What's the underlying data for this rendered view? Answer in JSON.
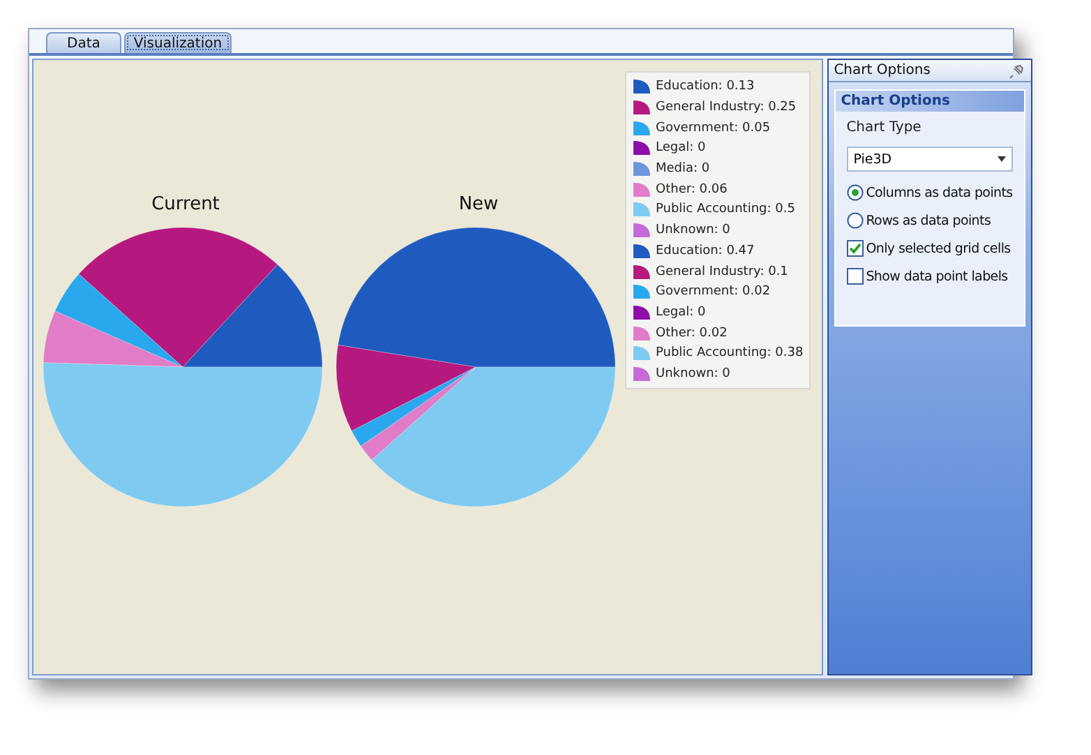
{
  "tabs": [
    {
      "label": "Data",
      "selected": false
    },
    {
      "label": "Visualization",
      "selected": true
    }
  ],
  "charts": [
    {
      "chart_data": {
        "type": "pie",
        "title": "Current",
        "values": [
          0.13,
          0.25,
          0.05,
          0,
          0,
          0.06,
          0.5,
          0
        ]
      },
      "legend": [
        {
          "label": "Education: 0.13",
          "color": "#1f5bbf"
        },
        {
          "label": "General Industry: 0.25",
          "color": "#b5197f"
        },
        {
          "label": "Government: 0.05",
          "color": "#2aa8ee"
        },
        {
          "label": "Legal: 0",
          "color": "#8e0fa8"
        },
        {
          "label": "Media: 0",
          "color": "#6c95db"
        },
        {
          "label": "Other: 0.06",
          "color": "#e07cc8"
        },
        {
          "label": "Public Accounting: 0.5",
          "color": "#7fcaf0"
        },
        {
          "label": "Unknown: 0",
          "color": "#c56ad6"
        }
      ]
    },
    {
      "chart_data": {
        "type": "pie",
        "title": "New",
        "values": [
          0.47,
          0.1,
          0.02,
          0,
          0.02,
          0.38,
          0
        ]
      },
      "legend": [
        {
          "label": "Education: 0.47",
          "color": "#1f5bbf"
        },
        {
          "label": "General Industry: 0.1",
          "color": "#b5197f"
        },
        {
          "label": "Government: 0.02",
          "color": "#2aa8ee"
        },
        {
          "label": "Legal: 0",
          "color": "#8e0fa8"
        },
        {
          "label": "Other: 0.02",
          "color": "#e07cc8"
        },
        {
          "label": "Public Accounting: 0.38",
          "color": "#7fcaf0"
        },
        {
          "label": "Unknown: 0",
          "color": "#c56ad6"
        }
      ]
    }
  ],
  "side_panel": {
    "title": "Chart Options",
    "section_title": "Chart Options",
    "chart_type_label": "Chart Type",
    "chart_type_value": "Pie3D",
    "options": [
      {
        "kind": "radio",
        "label": "Columns as data points",
        "selected": true
      },
      {
        "kind": "radio",
        "label": "Rows as data points",
        "selected": false
      },
      {
        "kind": "checkbox",
        "label": "Only selected grid cells",
        "checked": true
      },
      {
        "kind": "checkbox",
        "label": "Show data point labels",
        "checked": false
      }
    ]
  }
}
